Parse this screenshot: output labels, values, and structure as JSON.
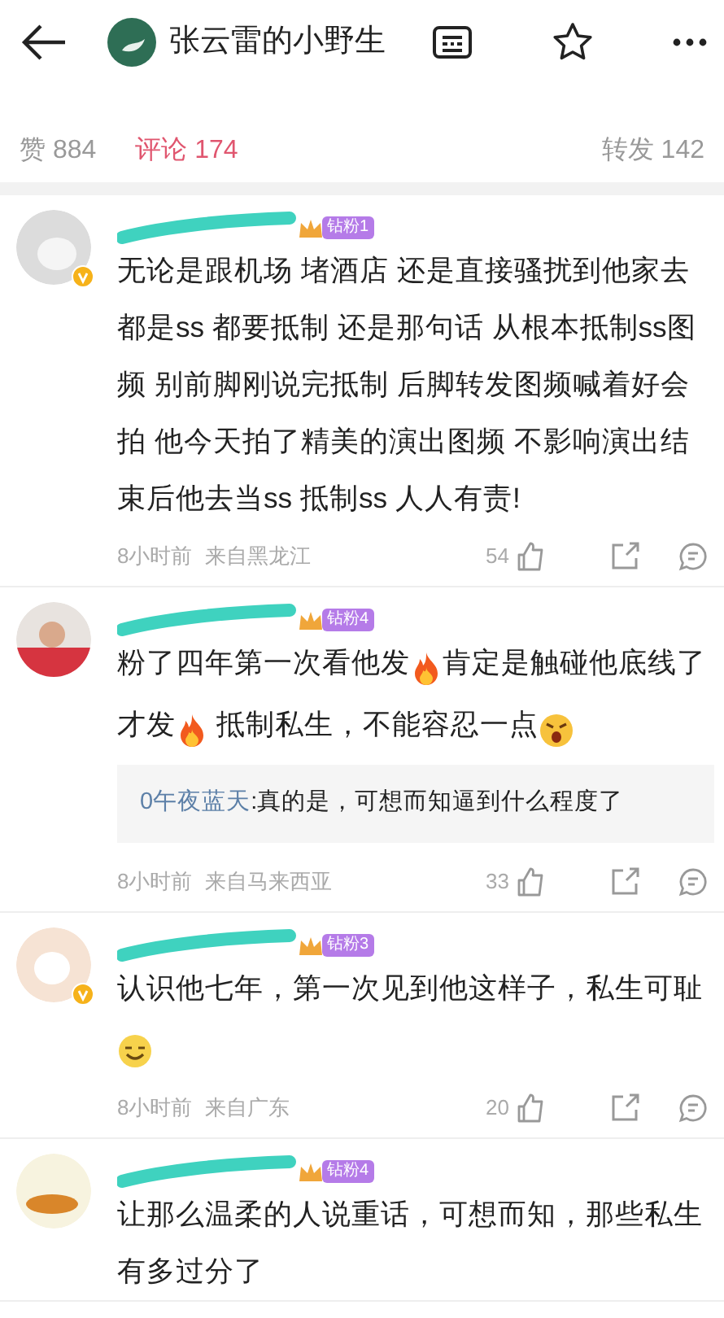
{
  "header": {
    "title": "张云雷的小野生"
  },
  "tabs": [
    {
      "label": "赞 884",
      "selected": false
    },
    {
      "label": "评论 174",
      "selected": true
    },
    {
      "label": "转发 142",
      "selected": false
    }
  ],
  "comments": [
    {
      "verified": true,
      "fan_badge": "钻粉1",
      "body": [
        {
          "kind": "text",
          "text": "无论是跟机场 堵酒店 还是直接骚扰到他家去都是ss 都要抵制 还是那句话 从根本抵制ss图频 别前脚刚说完抵制 后脚转发图频喊着好会拍 他今天拍了精美的演出图频 不影响演出结束后他去当ss 抵制ss 人人有责!"
        }
      ],
      "time": "8小时前",
      "location": "来自黑龙江",
      "likes": "54"
    },
    {
      "verified": false,
      "fan_badge": "钻粉4",
      "body": [
        {
          "kind": "text",
          "text": "粉了四年第一次看他发"
        },
        {
          "kind": "fire"
        },
        {
          "kind": "text",
          "text": "肯定是触碰他底线了才发"
        },
        {
          "kind": "fire"
        },
        {
          "kind": "text",
          "text": " 抵制私生，不能容忍一点"
        },
        {
          "kind": "angry"
        }
      ],
      "reply": {
        "author": "0午夜蓝天",
        "text": ":真的是，可想而知逼到什么程度了"
      },
      "time": "8小时前",
      "location": "来自马来西亚",
      "likes": "33"
    },
    {
      "verified": true,
      "fan_badge": "钻粉3",
      "body": [
        {
          "kind": "text",
          "text": "认识他七年，第一次见到他这样子，私生可耻"
        },
        {
          "kind": "grin"
        }
      ],
      "time": "8小时前",
      "location": "来自广东",
      "likes": "20"
    },
    {
      "verified": false,
      "fan_badge": "钻粉4",
      "body": [
        {
          "kind": "text",
          "text": "让那么温柔的人说重话，可想而知，那些私生有多过分了"
        }
      ]
    }
  ]
}
